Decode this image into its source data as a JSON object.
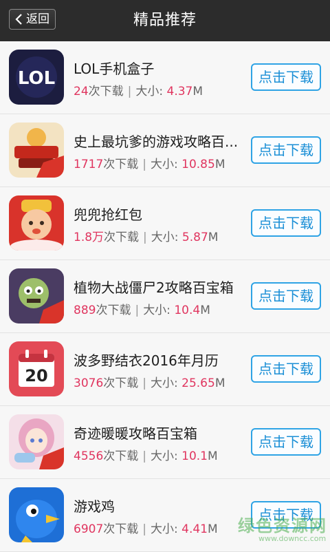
{
  "header": {
    "back_label": "返回",
    "title": "精品推荐"
  },
  "items": [
    {
      "name": "LOL手机盒子",
      "downloads": "24",
      "downloads_suffix": "次下载",
      "size_label": "大小:",
      "size_value": "4.37",
      "size_unit": "M",
      "button": "点击下载",
      "icon": "lol-box-icon"
    },
    {
      "name": "史上最坑爹的游戏攻略百...",
      "downloads": "1717",
      "downloads_suffix": "次下载",
      "size_label": "大小:",
      "size_value": "10.85",
      "size_unit": "M",
      "button": "点击下载",
      "icon": "game-guide-icon"
    },
    {
      "name": "兜兜抢红包",
      "downloads": "1.8万",
      "downloads_suffix": "次下载",
      "size_label": "大小:",
      "size_value": "5.87",
      "size_unit": "M",
      "button": "点击下载",
      "icon": "red-envelope-icon"
    },
    {
      "name": "植物大战僵尸2攻略百宝箱",
      "downloads": "889",
      "downloads_suffix": "次下载",
      "size_label": "大小:",
      "size_value": "10.4",
      "size_unit": "M",
      "button": "点击下载",
      "icon": "zombie-icon"
    },
    {
      "name": "波多野结衣2016年月历",
      "downloads": "3076",
      "downloads_suffix": "次下载",
      "size_label": "大小:",
      "size_value": "25.65",
      "size_unit": "M",
      "button": "点击下载",
      "icon": "calendar-icon"
    },
    {
      "name": "奇迹暖暖攻略百宝箱",
      "downloads": "4556",
      "downloads_suffix": "次下载",
      "size_label": "大小:",
      "size_value": "10.1",
      "size_unit": "M",
      "button": "点击下载",
      "icon": "anime-girl-icon"
    },
    {
      "name": "游戏鸡",
      "downloads": "6907",
      "downloads_suffix": "次下载",
      "size_label": "大小:",
      "size_value": "4.41",
      "size_unit": "M",
      "button": "点击下载",
      "icon": "blue-bird-icon"
    }
  ],
  "watermark": {
    "text": "绿色资源网",
    "url": "www.downcc.com"
  }
}
